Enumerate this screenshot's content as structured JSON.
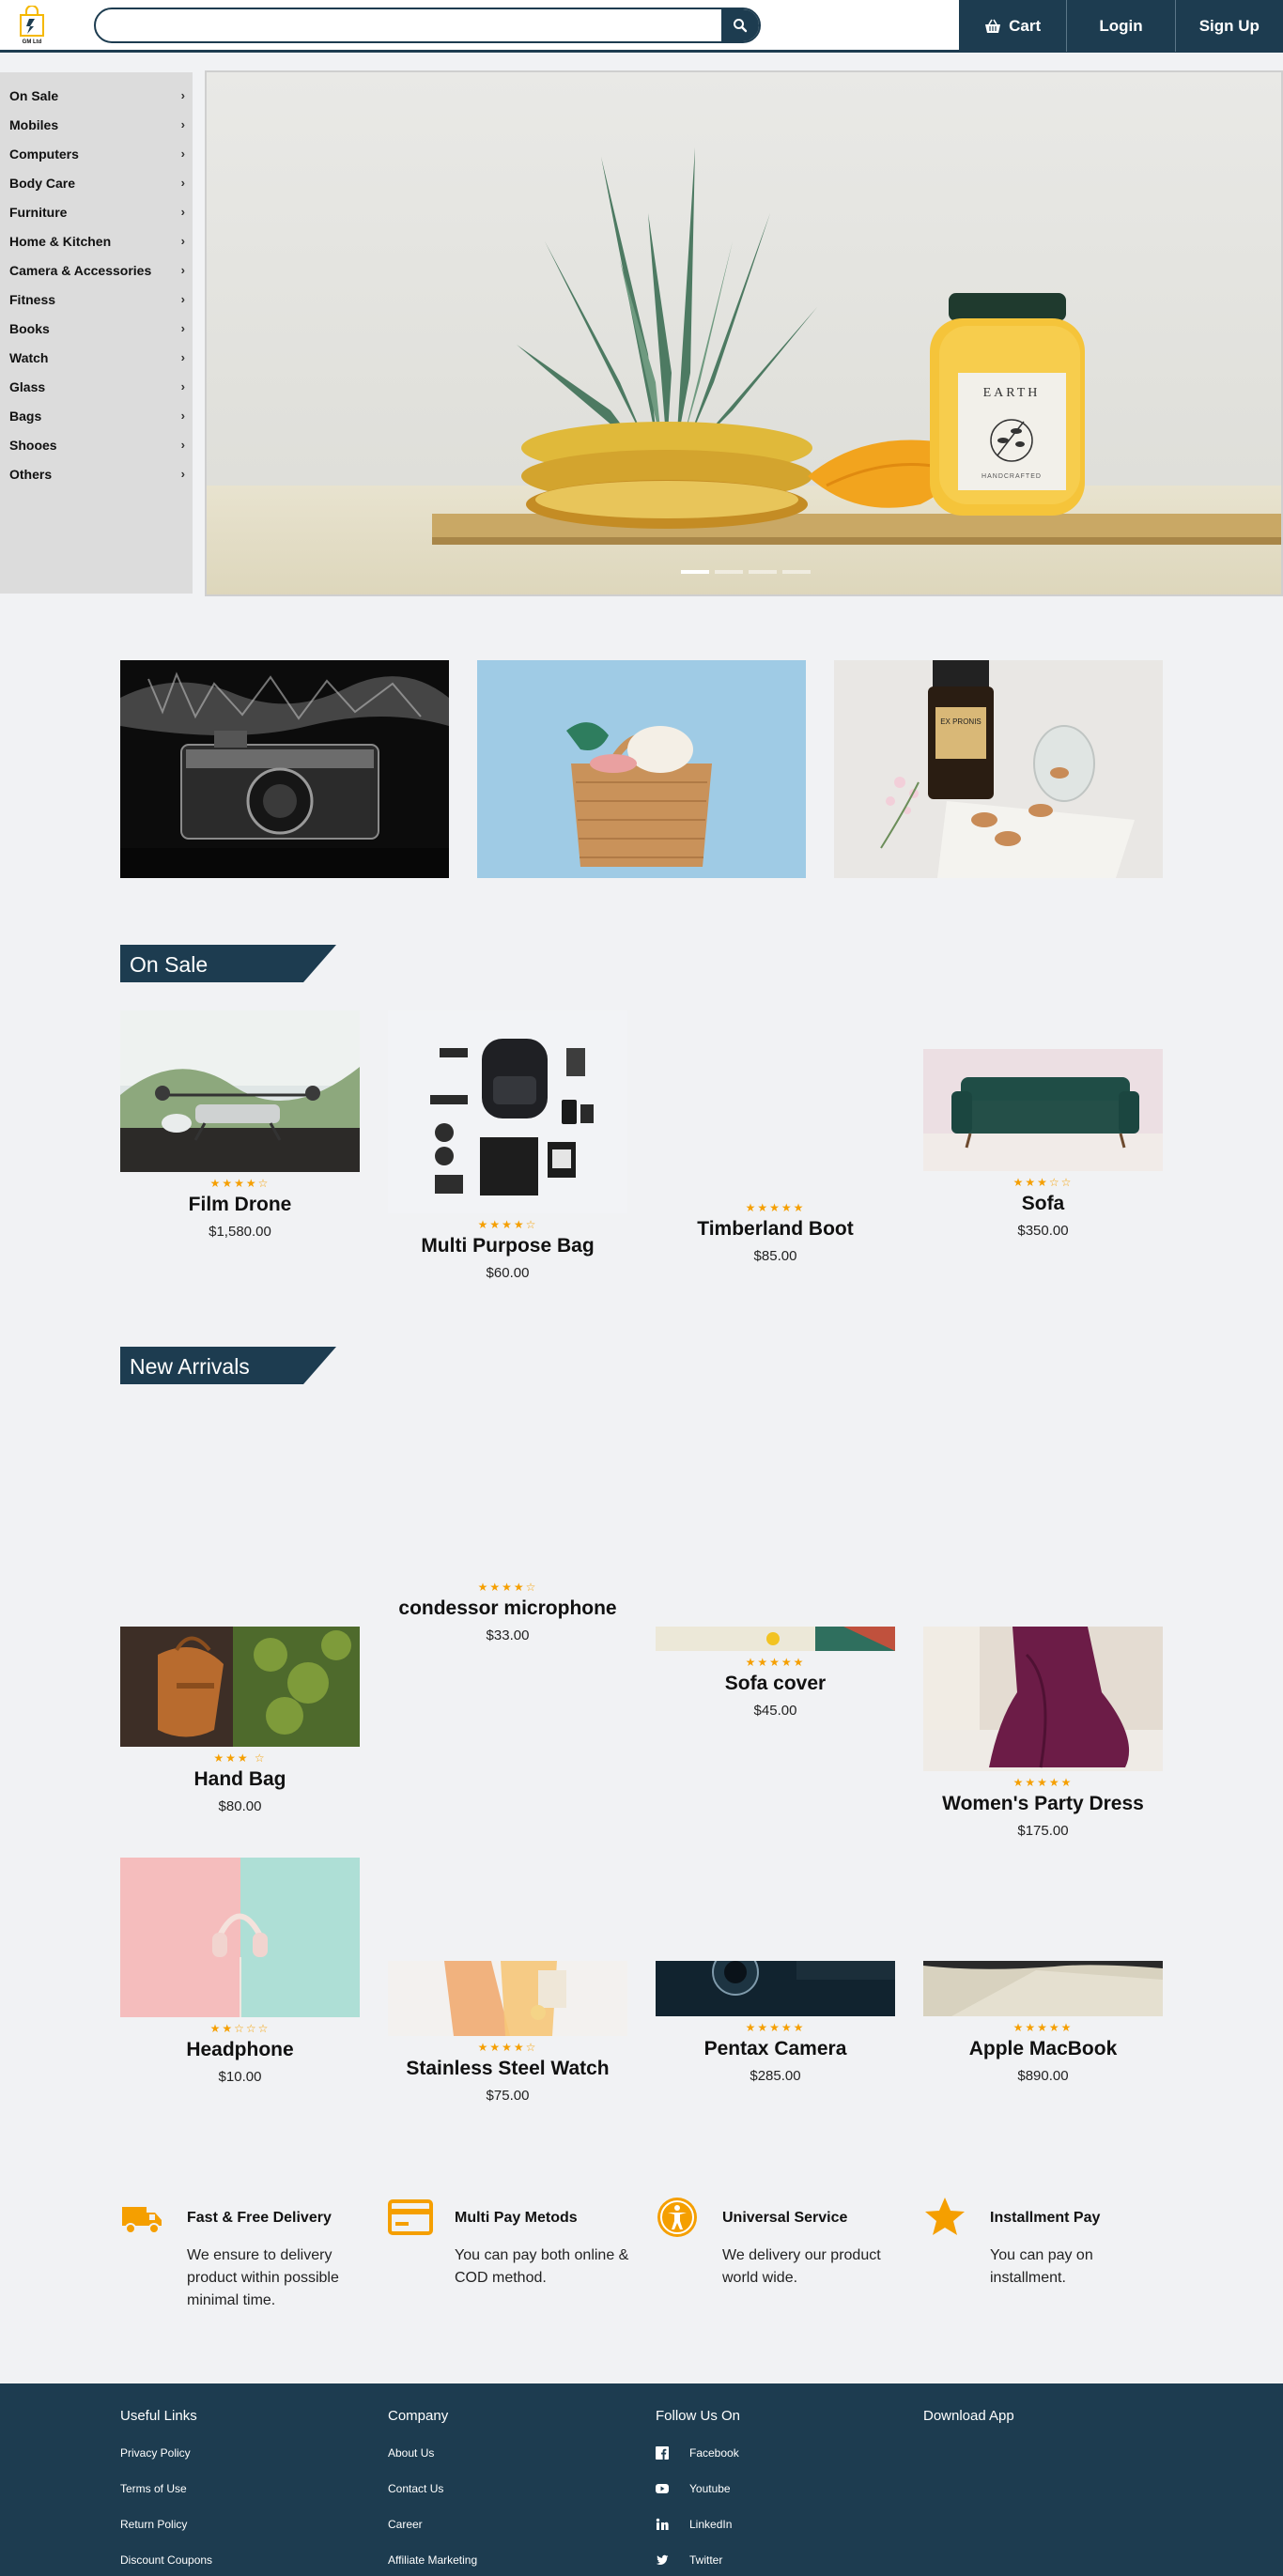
{
  "header": {
    "logo_text": "GM Ltd",
    "search": {
      "placeholder": "",
      "value": ""
    },
    "nav": {
      "cart": "Cart",
      "login": "Login",
      "signup": "Sign Up"
    }
  },
  "sidebar": {
    "items": [
      {
        "label": "On Sale"
      },
      {
        "label": "Mobiles"
      },
      {
        "label": "Computers"
      },
      {
        "label": "Body Care"
      },
      {
        "label": "Furniture"
      },
      {
        "label": "Home & Kitchen"
      },
      {
        "label": "Camera & Accessories"
      },
      {
        "label": "Fitness"
      },
      {
        "label": "Books"
      },
      {
        "label": "Watch"
      },
      {
        "label": "Glass"
      },
      {
        "label": "Bags"
      },
      {
        "label": "Shooes"
      },
      {
        "label": "Others"
      }
    ]
  },
  "hero": {
    "jar_brand": "EARTH",
    "jar_sub": "HANDCRAFTED",
    "slides": 4,
    "active_slide": 1
  },
  "promos": [
    "camera-in-water",
    "basket-bag",
    "ex-pronis-bottle"
  ],
  "on_sale": {
    "title": "On Sale",
    "products": [
      {
        "name": "Film Drone",
        "price": "$1,580.00",
        "rating": 4.5
      },
      {
        "name": "Multi Purpose Bag",
        "price": "$60.00",
        "rating": 4.5
      },
      {
        "name": "Timberland Boot",
        "price": "$85.00",
        "rating": 5
      },
      {
        "name": "Sofa",
        "price": "$350.00",
        "rating": 3.5
      }
    ]
  },
  "new_arrivals": {
    "title": "New Arrivals",
    "products": [
      {
        "name": "Hand Bag",
        "price": "$80.00",
        "rating": 3
      },
      {
        "name": "condessor microphone",
        "price": "$33.00",
        "rating": 4.5
      },
      {
        "name": "Sofa cover",
        "price": "$45.00",
        "rating": 5
      },
      {
        "name": "Women's Party Dress",
        "price": "$175.00",
        "rating": 5
      },
      {
        "name": "Headphone",
        "price": "$10.00",
        "rating": 2.5
      },
      {
        "name": "Stainless Steel Watch",
        "price": "$75.00",
        "rating": 4.5
      },
      {
        "name": "Pentax Camera",
        "price": "$285.00",
        "rating": 5
      },
      {
        "name": "Apple MacBook",
        "price": "$890.00",
        "rating": 5
      }
    ]
  },
  "features": [
    {
      "title": "Fast & Free Delivery",
      "text": "We ensure to delivery product within possible minimal time.",
      "icon": "truck-icon"
    },
    {
      "title": "Multi Pay Metods",
      "text": "You can pay both online & COD method.",
      "icon": "credit-card-icon"
    },
    {
      "title": "Universal Service",
      "text": "We delivery our product world wide.",
      "icon": "universal-access-icon"
    },
    {
      "title": "Installment Pay",
      "text": "You can pay on installment.",
      "icon": "star-icon"
    }
  ],
  "footer": {
    "useful_links": {
      "title": "Useful Links",
      "links": [
        "Privacy Policy",
        "Terms of Use",
        "Return Policy",
        "Discount Coupons"
      ]
    },
    "company": {
      "title": "Company",
      "links": [
        "About Us",
        "Contact Us",
        "Career",
        "Affiliate Marketing"
      ]
    },
    "follow": {
      "title": "Follow Us On",
      "links": [
        "Facebook",
        "Youtube",
        "LinkedIn",
        "Twitter"
      ]
    },
    "download": {
      "title": "Download App"
    }
  },
  "colors": {
    "primary": "#1d3c50",
    "accent": "#f59f00",
    "page_bg": "#f1f2f4",
    "sidebar_bg": "#dcdcdc"
  }
}
